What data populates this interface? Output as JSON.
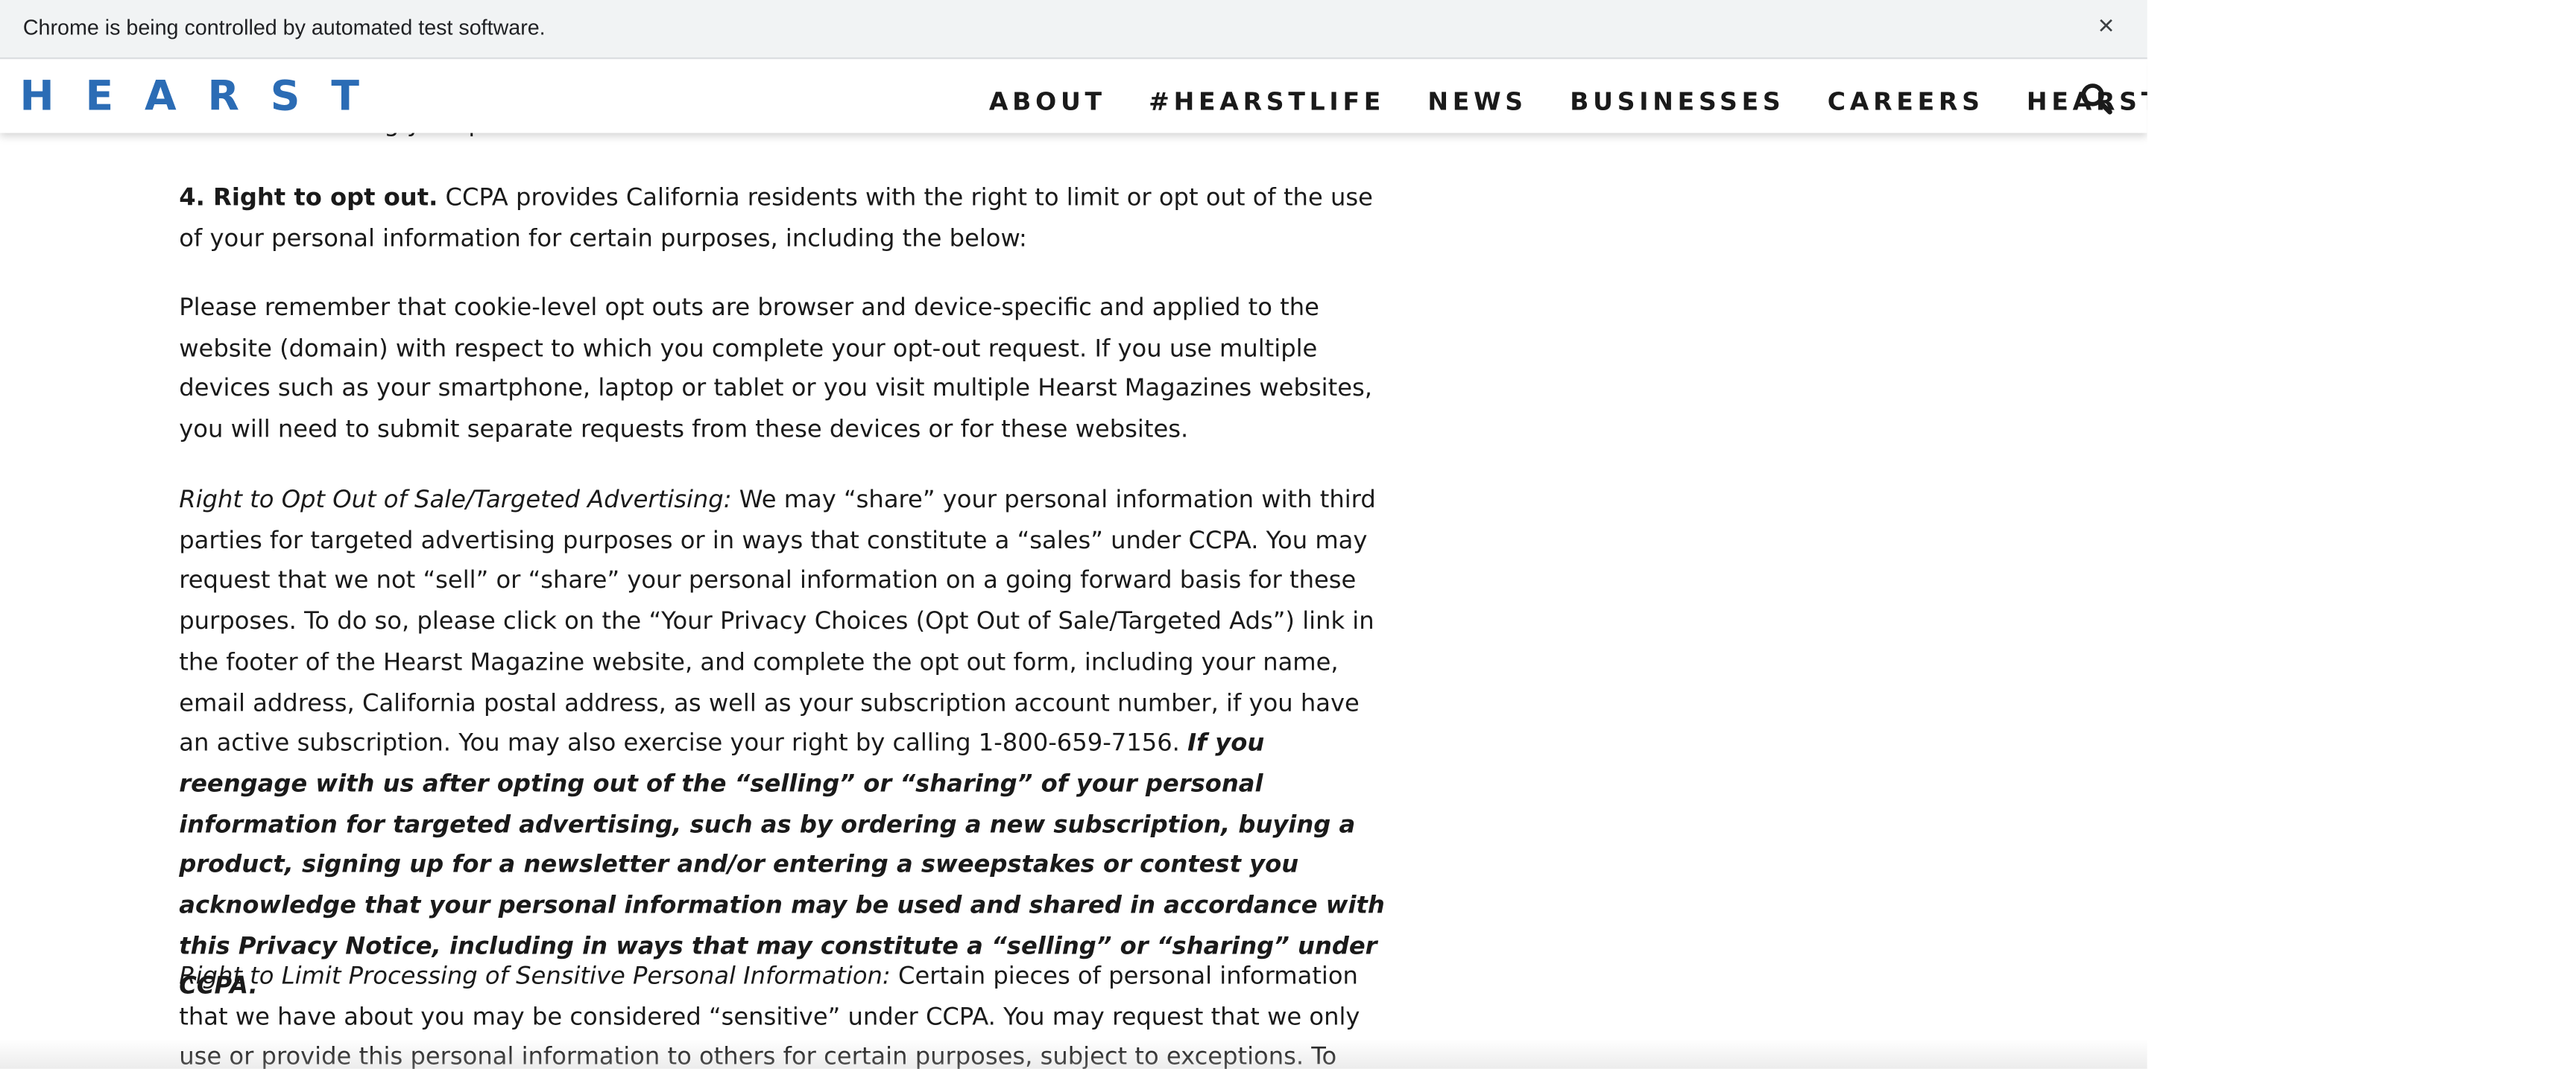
{
  "infobar": {
    "message": "Chrome is being controlled by automated test software.",
    "close_glyph": "×"
  },
  "header": {
    "logo": "HEARST",
    "nav": [
      "ABOUT",
      "#HEARSTLIFE",
      "NEWS",
      "BUSINESSES",
      "CAREERS",
      "HEARSTLINK"
    ],
    "search_icon": "search-icon"
  },
  "article": {
    "partial_top": "re-subscribe using your preferred email address.",
    "opt_out_heading": "4. Right to opt out.",
    "opt_out_text": " CCPA provides California residents with the right to limit or opt out of the use of your personal information for certain purposes, including the below:",
    "cookie_text": "Please remember that cookie-level opt outs are browser and device-specific and applied to the website (domain) with respect to which you complete your opt-out request. If you use multiple devices such as your smartphone, laptop or tablet or you visit multiple Hearst Magazines websites, you will need to submit separate requests from these devices or for these websites.",
    "sale_label": "Right to Opt Out of Sale/Targeted Advertising:",
    "sale_text": " We may “share” your personal information with third parties for targeted advertising purposes or in ways that constitute a “sales” under CCPA. You may request that we not “sell” or “share” your personal information on a going forward basis for these purposes. To do so, please click on the “Your Privacy Choices (Opt Out of Sale/Targeted Ads”) link in the footer of the Hearst Magazine website, and complete the opt out form, including your name, email address, California postal address, as well as your subscription account number, if you have an active subscription.  You may also exercise your right by calling 1-800-659-7156. ",
    "sale_bold": "If you reengage with us after opting out of the “selling”  or “sharing”  of your personal information for targeted advertising, such as by ordering a new subscription, buying a product, signing up for a newsletter and/or entering a sweepstakes or contest you acknowledge that your personal information may be used and shared in accordance with this Privacy Notice, including in ways that may constitute a “selling” or “sharing” under CCPA.",
    "limit_label": "Right to Limit Processing of Sensitive Personal Information:",
    "limit_text": " Certain pieces of personal information that we have about you may be considered “sensitive” under CCPA. You may request that we only use or provide this personal information to others for certain purposes, subject to exceptions. To submit a request to limit the"
  },
  "colors": {
    "logo": "#2b6cb5",
    "text": "#1a1a1a",
    "infobar_bg": "#f1f3f4"
  }
}
